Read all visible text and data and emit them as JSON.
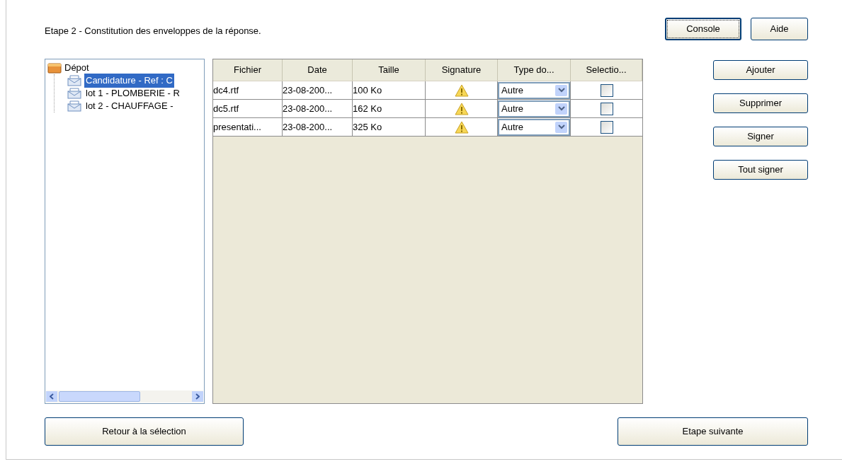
{
  "title": "Etape 2 - Constitution des enveloppes de la réponse.",
  "top_buttons": [
    {
      "label": "Console",
      "focused": true
    },
    {
      "label": "Aide",
      "focused": false
    }
  ],
  "tree": {
    "label": "Dépot",
    "expanded": true,
    "children": [
      {
        "label": "Candidature - Ref : C",
        "selected": true
      },
      {
        "label": "lot 1 - PLOMBERIE - R",
        "selected": false
      },
      {
        "label": "lot 2 - CHAUFFAGE -",
        "selected": false
      }
    ]
  },
  "table": {
    "columns": [
      "Fichier",
      "Date",
      "Taille",
      "Signature",
      "Type do...",
      "Selectio..."
    ],
    "rows": [
      {
        "file": "dc4.rtf",
        "date": "23-08-200...",
        "size": "100 Ko",
        "signed": false,
        "type": "Autre",
        "checked": false
      },
      {
        "file": "dc5.rtf",
        "date": "23-08-200...",
        "size": "162 Ko",
        "signed": false,
        "type": "Autre",
        "checked": false
      },
      {
        "file": "presentati...",
        "date": "23-08-200...",
        "size": "325 Ko",
        "signed": false,
        "type": "Autre",
        "checked": false
      }
    ]
  },
  "side_buttons": [
    "Ajouter",
    "Supprimer",
    "Signer",
    "Tout signer"
  ],
  "back_button": "Retour à la sélection",
  "next_button": "Etape suivante"
}
